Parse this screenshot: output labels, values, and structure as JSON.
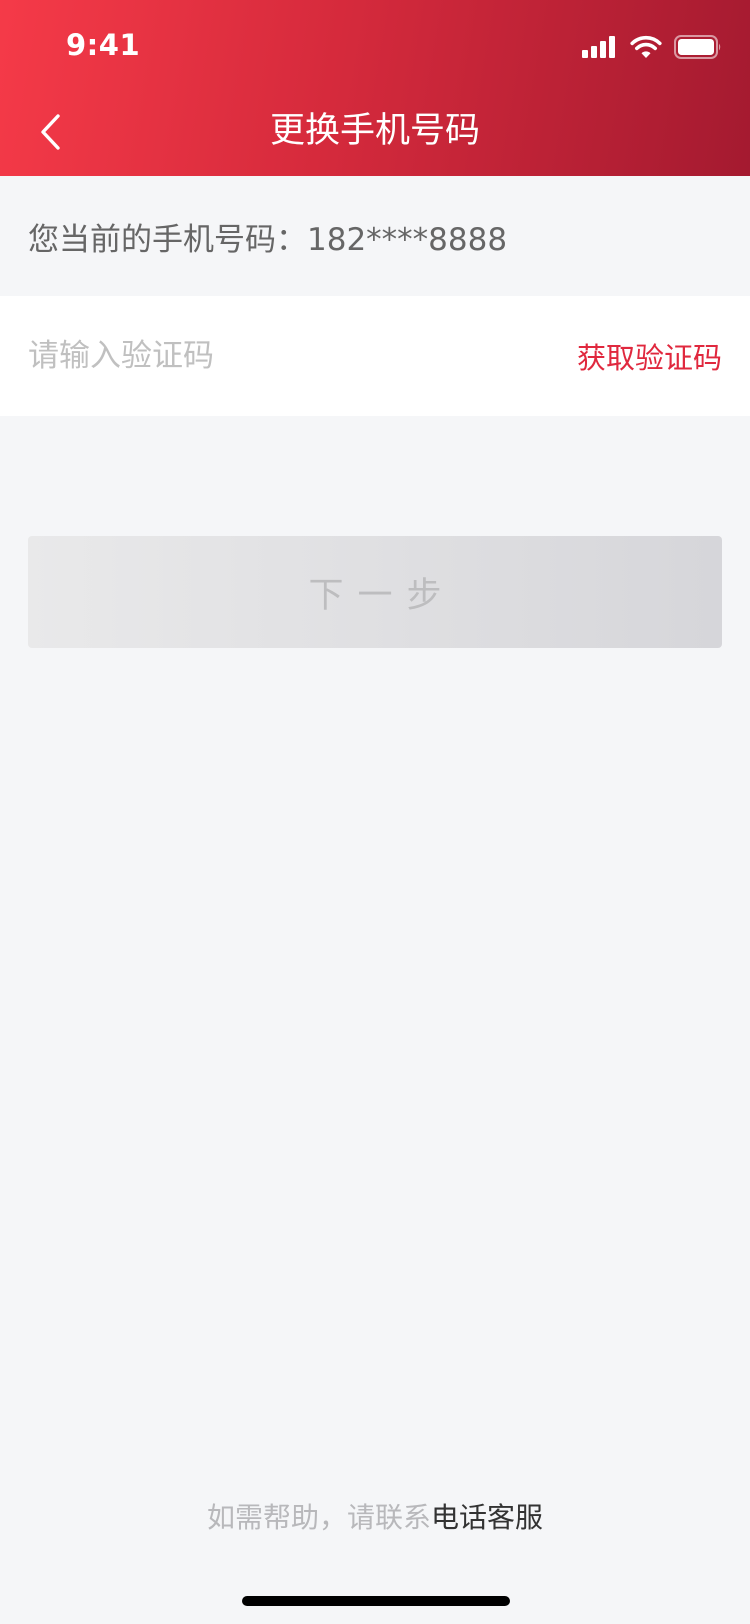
{
  "status_bar": {
    "time": "9:41",
    "signal_icon": "cellular-signal-icon",
    "wifi_icon": "wifi-icon",
    "battery_icon": "battery-icon"
  },
  "nav": {
    "back_icon": "chevron-left-icon",
    "title": "更换手机号码"
  },
  "current_phone": {
    "label": "您当前的手机号码：182****8888"
  },
  "verification": {
    "placeholder": "请输入验证码",
    "value": "",
    "get_code_label": "获取验证码"
  },
  "next_button": {
    "label": "下一步"
  },
  "help": {
    "prefix": "如需帮助，请联系",
    "link": "电话客服"
  },
  "colors": {
    "header_start": "#f53a48",
    "header_end": "#a41a30",
    "accent": "#e0283e",
    "background": "#f5f6f8",
    "disabled_button": "#dcdcdf"
  }
}
